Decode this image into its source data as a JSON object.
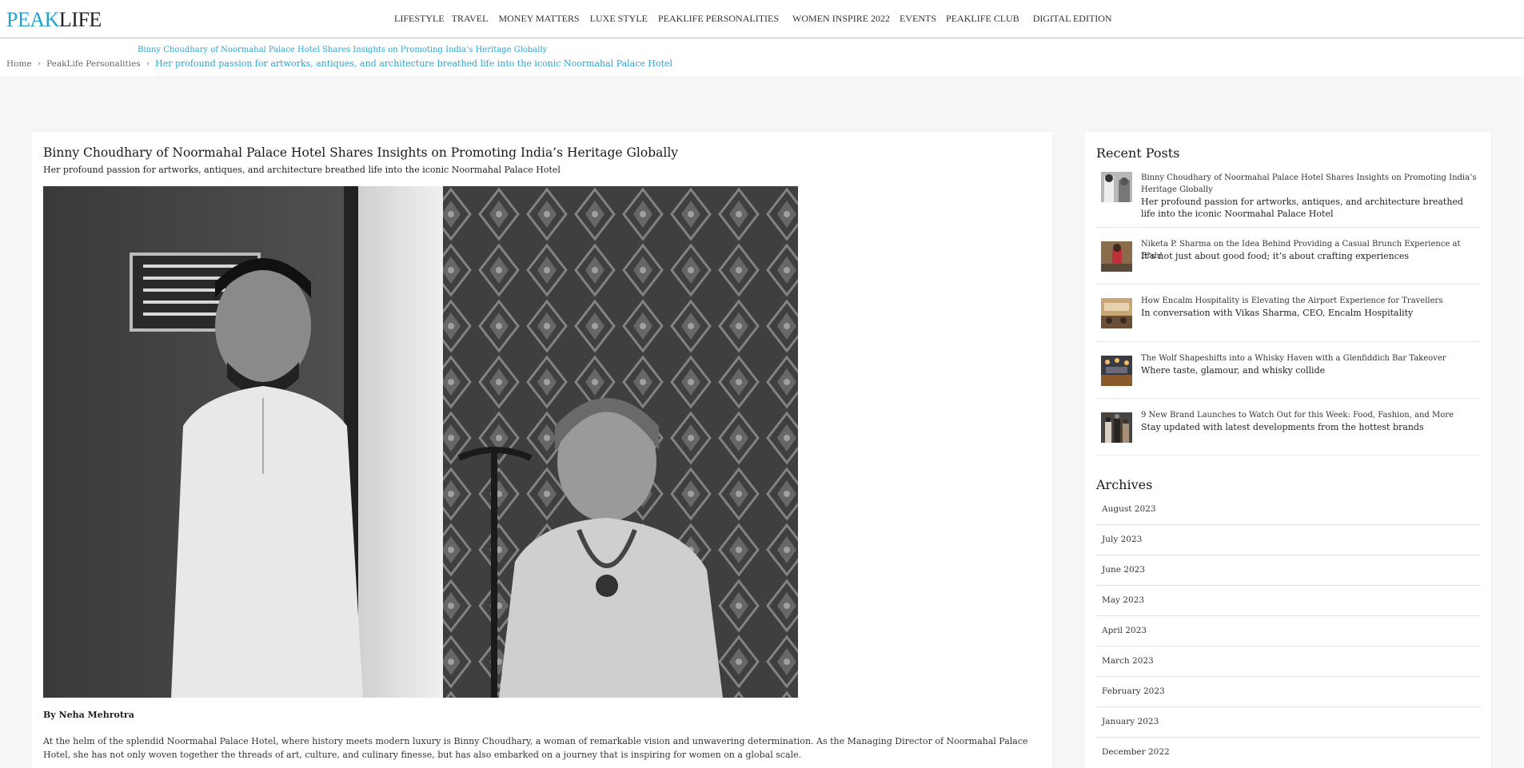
{
  "brand": {
    "logo_part1": "PEAK",
    "logo_part2": "LIFE",
    "accent_color": "#1fa2d2"
  },
  "nav": [
    "LIFESTYLE",
    "TRAVEL",
    "MONEY MATTERS",
    "LUXE STYLE",
    "PEAKLIFE PERSONALITIES",
    "WOMEN INSPIRE 2022",
    "EVENTS",
    "PEAKLIFE CLUB",
    "DIGITAL EDITION"
  ],
  "breadcrumb": {
    "home": "Home",
    "section": "PeakLife Personalities",
    "current_title": "Binny Choudhary of Noormahal Palace Hotel Shares Insights on Promoting India’s Heritage Globally",
    "current_subtitle": "Her profound passion for artworks, antiques, and architecture breathed life into the iconic Noormahal Palace Hotel"
  },
  "article": {
    "title": "Binny Choudhary of Noormahal Palace Hotel Shares Insights on Promoting India’s Heritage Globally",
    "subtitle": "Her profound passion for artworks, antiques, and architecture breathed life into the iconic Noormahal Palace Hotel",
    "byline": "By Neha Mehrotra",
    "paragraph": "At the helm of the splendid Noormahal Palace Hotel, where history meets modern luxury is Binny Choudhary, a woman of remarkable vision and unwavering determination. As the Managing Director of Noormahal Palace Hotel, she has not only woven together the threads of art, culture, and culinary finesse, but has also embarked on a journey that is inspiring for women on a global scale."
  },
  "sidebar": {
    "recent_heading": "Recent Posts",
    "recent_posts": [
      {
        "title": "Binny Choudhary of Noormahal Palace Hotel Shares Insights on Promoting India’s Heritage Globally",
        "subtitle": "Her profound passion for artworks, antiques, and architecture breathed life into the iconic Noormahal Palace Hotel"
      },
      {
        "title": "Niketa P. Sharma on the Idea Behind Providing a Casual Brunch Experience at Blah!",
        "subtitle": "It’s not just about good food; it’s about crafting experiences"
      },
      {
        "title": "How Encalm Hospitality is Elevating the Airport Experience for Travellers",
        "subtitle": "In conversation with Vikas Sharma, CEO, Encalm Hospitality"
      },
      {
        "title": "The Wolf Shapeshifts into a Whisky Haven with a Glenfiddich Bar Takeover",
        "subtitle": "Where taste, glamour, and whisky collide"
      },
      {
        "title": "9 New Brand Launches to Watch Out for this Week: Food, Fashion, and More",
        "subtitle": "Stay updated with latest developments from the hottest brands"
      }
    ],
    "archives_heading": "Archives",
    "archives": [
      "August 2023",
      "July 2023",
      "June 2023",
      "May 2023",
      "April 2023",
      "March 2023",
      "February 2023",
      "January 2023",
      "December 2022"
    ]
  }
}
